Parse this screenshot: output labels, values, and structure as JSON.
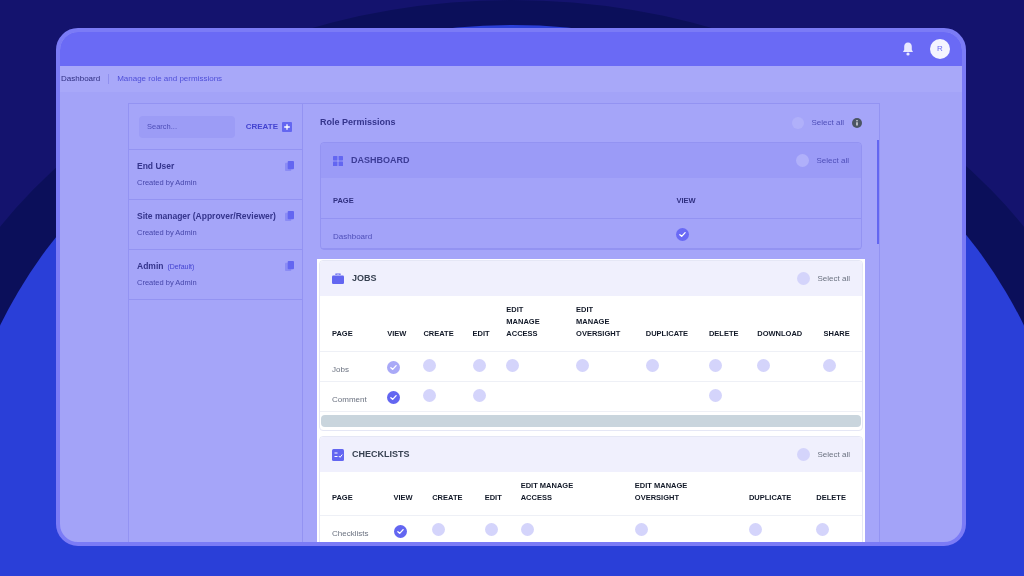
{
  "top_bar": {
    "avatar_initial": "R"
  },
  "breadcrumb": [
    {
      "label": "Dashboard",
      "selected": false
    },
    {
      "label": "Manage role and permissions",
      "selected": true
    }
  ],
  "roles_panel": {
    "search": {
      "placeholder": "Search..."
    },
    "create_label": "CREATE",
    "roles": [
      {
        "name": "End User",
        "subtitle": "Created by Admin"
      },
      {
        "name": "Site manager (Approver/Reviewer)",
        "subtitle": "Created by Admin"
      },
      {
        "name": "Admin",
        "tag": "(Default)",
        "subtitle": "Created by Admin"
      }
    ]
  },
  "permissions": {
    "title": "Role Permissions",
    "select_all": {
      "label": "Select all",
      "checked": false
    },
    "sections": [
      {
        "kind": "grid",
        "title": "DASHBOARD",
        "highlighted": false,
        "select_all": {
          "label": "Select all",
          "checked": false
        },
        "columns": [
          "PAGE",
          "VIEW"
        ],
        "rows": [
          {
            "page": "Dashboard",
            "cells": [
              {
                "kind": "checkbox",
                "checked": true,
                "disabled": false
              }
            ]
          }
        ],
        "scrollbar": false
      },
      {
        "kind": "briefcase",
        "title": "JOBS",
        "highlighted": true,
        "select_all": {
          "label": "Select all",
          "checked": false
        },
        "columns": [
          "PAGE",
          "VIEW",
          "CREATE",
          "EDIT",
          "EDIT MANAGE ACCESS",
          "EDIT MANAGE OVERSIGHT",
          "DUPLICATE",
          "DELETE",
          "DOWNLOAD",
          "SHARE"
        ],
        "rows": [
          {
            "page": "Jobs",
            "cells": [
              {
                "kind": "checkbox",
                "checked": true,
                "disabled": true
              },
              {
                "kind": "checkbox",
                "checked": false,
                "disabled": false
              },
              {
                "kind": "checkbox",
                "checked": false,
                "disabled": false
              },
              {
                "kind": "checkbox",
                "checked": false,
                "disabled": false
              },
              {
                "kind": "checkbox",
                "checked": false,
                "disabled": false
              },
              {
                "kind": "checkbox",
                "checked": false,
                "disabled": false
              },
              {
                "kind": "checkbox",
                "checked": false,
                "disabled": false
              },
              {
                "kind": "checkbox",
                "checked": false,
                "disabled": false
              },
              {
                "kind": "checkbox",
                "checked": false,
                "disabled": false
              }
            ]
          },
          {
            "page": "Comment",
            "cells": [
              {
                "kind": "checkbox",
                "checked": true,
                "disabled": false
              },
              {
                "kind": "checkbox",
                "checked": false,
                "disabled": false
              },
              {
                "kind": "checkbox",
                "checked": false,
                "disabled": false
              },
              {
                "kind": "empty"
              },
              {
                "kind": "empty"
              },
              {
                "kind": "empty"
              },
              {
                "kind": "checkbox",
                "checked": false,
                "disabled": false
              },
              {
                "kind": "empty"
              },
              {
                "kind": "empty"
              }
            ]
          }
        ],
        "scrollbar": true
      },
      {
        "kind": "checklist",
        "title": "CHECKLISTS",
        "highlighted": true,
        "select_all": {
          "label": "Select all",
          "checked": false
        },
        "columns": [
          "PAGE",
          "VIEW",
          "CREATE",
          "EDIT",
          "EDIT MANAGE ACCESS",
          "EDIT MANAGE OVERSIGHT",
          "DUPLICATE",
          "DELETE"
        ],
        "rows": [
          {
            "page": "Checklists",
            "cells": [
              {
                "kind": "checkbox",
                "checked": true,
                "disabled": false
              },
              {
                "kind": "checkbox",
                "checked": false,
                "disabled": false
              },
              {
                "kind": "checkbox",
                "checked": false,
                "disabled": false
              },
              {
                "kind": "checkbox",
                "checked": false,
                "disabled": false
              },
              {
                "kind": "checkbox",
                "checked": false,
                "disabled": false
              },
              {
                "kind": "checkbox",
                "checked": false,
                "disabled": false
              },
              {
                "kind": "checkbox",
                "checked": false,
                "disabled": false
              }
            ]
          }
        ],
        "scrollbar": false
      }
    ]
  }
}
